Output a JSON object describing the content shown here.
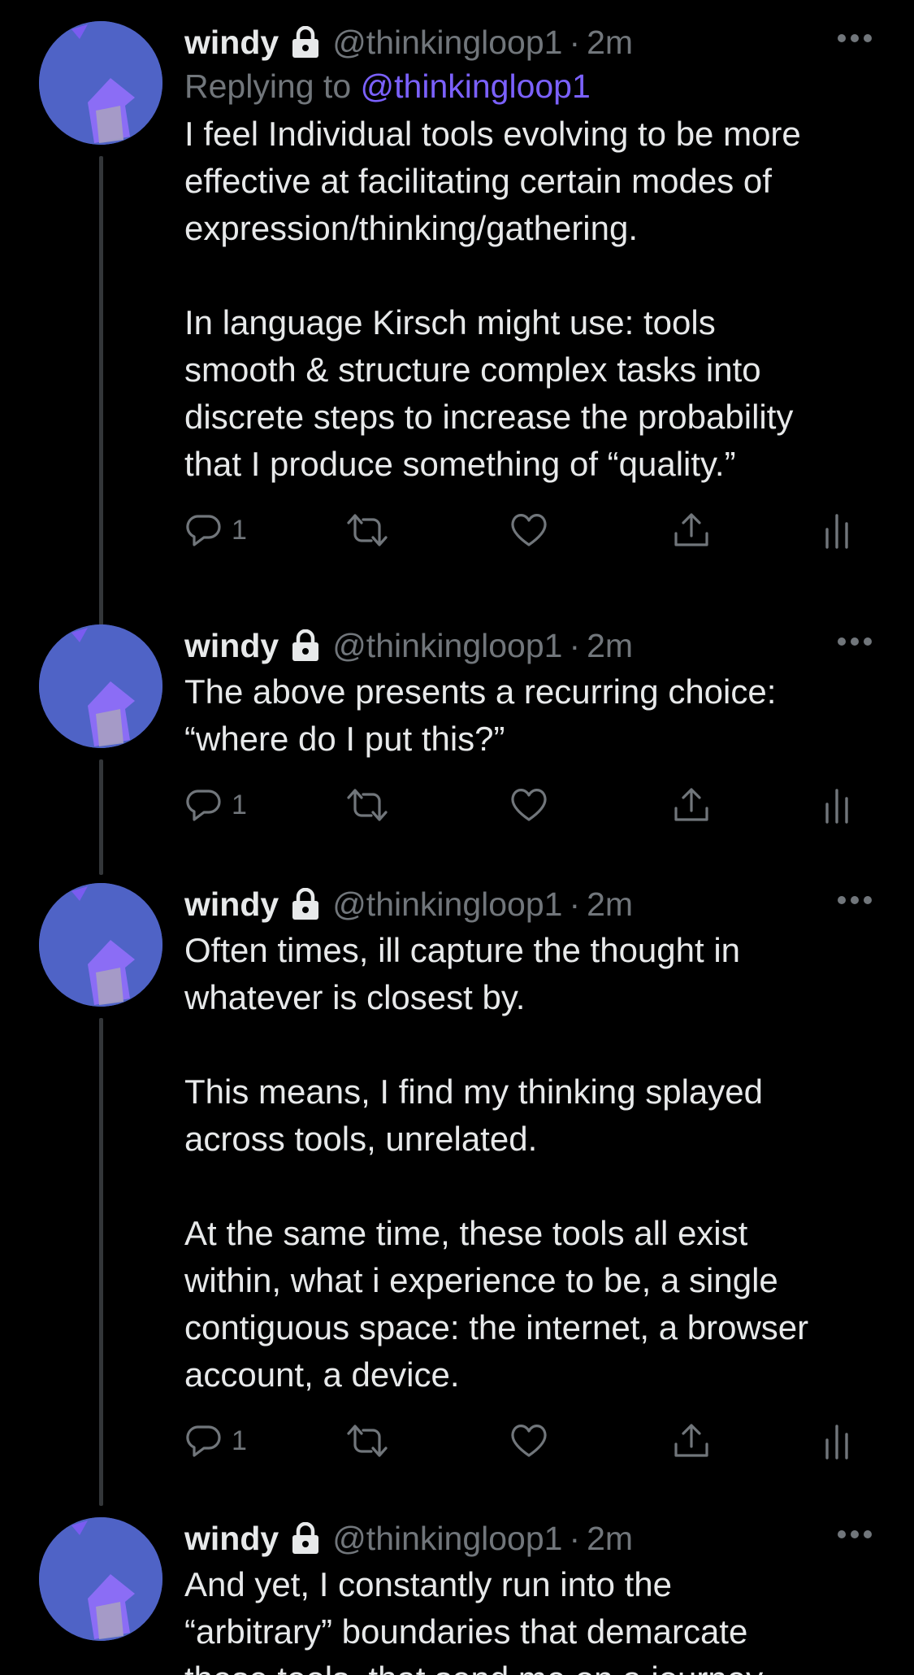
{
  "tweets": [
    {
      "name": "windy",
      "handle": "@thinkingloop1",
      "separator": "·",
      "time": "2m",
      "replying_prefix": "Replying to",
      "replying_handle": "@thinkingloop1",
      "text": "I feel Individual tools evolving to be more\neffective at facilitating certain modes of\nexpression/thinking/gathering.\n\nIn language Kirsch might use: tools\nsmooth & structure complex tasks into\ndiscrete steps to increase the probability\nthat I produce something of “quality.”",
      "reply_count": "1"
    },
    {
      "name": "windy",
      "handle": "@thinkingloop1",
      "separator": "·",
      "time": "2m",
      "text": "The above presents a recurring choice:\n“where do I put this?”",
      "reply_count": "1"
    },
    {
      "name": "windy",
      "handle": "@thinkingloop1",
      "separator": "·",
      "time": "2m",
      "text": "Often times, ill capture the thought in\nwhatever is closest by.\n\nThis means, I find my thinking splayed\nacross tools, unrelated.\n\nAt the same time, these tools all exist\nwithin, what i experience to be, a single\ncontiguous space: the internet, a browser\naccount, a device.",
      "reply_count": "1"
    },
    {
      "name": "windy",
      "handle": "@thinkingloop1",
      "separator": "·",
      "time": "2m",
      "text": "And yet, I constantly run into the\n“arbitrary” boundaries that demarcate\nthese tools, that send me on a journey"
    }
  ],
  "icons": {
    "avatar": "avatar-illustration",
    "lock": "lock-icon",
    "more": "more-icon",
    "reply": "reply-icon",
    "retweet": "retweet-icon",
    "like": "heart-icon",
    "share": "share-icon",
    "analytics": "analytics-icon"
  },
  "colors": {
    "background": "#000000",
    "text": "#e7e9ea",
    "muted": "#71767b",
    "link": "#7b61ff",
    "thread_line": "#333639",
    "avatar_bg": "#4f63c6"
  }
}
